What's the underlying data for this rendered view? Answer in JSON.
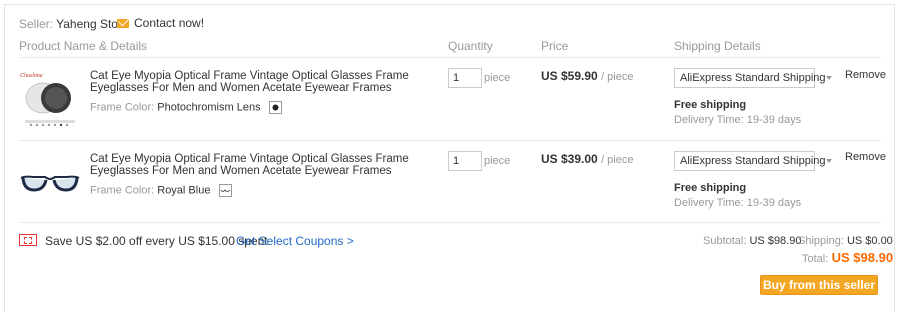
{
  "header": {
    "seller_label": "Seller:",
    "seller_name": "Yaheng Store",
    "contact_label": "Contact now!"
  },
  "columns": {
    "product": "Product Name & Details",
    "quantity": "Quantity",
    "price": "Price",
    "shipping": "Shipping Details"
  },
  "items": [
    {
      "title": "Cat Eye Myopia Optical Frame Vintage Optical Glasses Frame Eyeglasses For Men and Women Acetate Eyewear Frames",
      "color_label": "Frame Color:",
      "color_value": "Photochromism Lens",
      "quantity": "1",
      "quantity_unit": "piece",
      "price": "US $59.90",
      "price_unit": "/ piece",
      "shipping_method": "AliExpress Standard Shipping",
      "shipping_cost": "Free shipping",
      "delivery": "Delivery Time: 19-39 days",
      "remove": "Remove",
      "thumb_brand": "Chashma"
    },
    {
      "title": "Cat Eye Myopia Optical Frame Vintage Optical Glasses Frame Eyeglasses For Men and Women Acetate Eyewear Frames",
      "color_label": "Frame Color:",
      "color_value": "Royal Blue",
      "quantity": "1",
      "quantity_unit": "piece",
      "price": "US $39.00",
      "price_unit": "/ piece",
      "shipping_method": "AliExpress Standard Shipping",
      "shipping_cost": "Free shipping",
      "delivery": "Delivery Time: 19-39 days",
      "remove": "Remove"
    }
  ],
  "coupon": {
    "text": "Save US $2.00 off every US $15.00 spent",
    "link": "Get Select Coupons >"
  },
  "summary": {
    "subtotal_label": "Subtotal:",
    "subtotal_value": "US $98.90",
    "shipping_label": "Shipping:",
    "shipping_value": "US $0.00",
    "total_label": "Total:",
    "total_value": "US $98.90"
  },
  "buy_button": "Buy from this seller",
  "colors": {
    "accent_orange": "#f5a623",
    "total_orange": "#ff6a00",
    "link_blue": "#2068c6",
    "coupon_red": "#e4393c"
  }
}
